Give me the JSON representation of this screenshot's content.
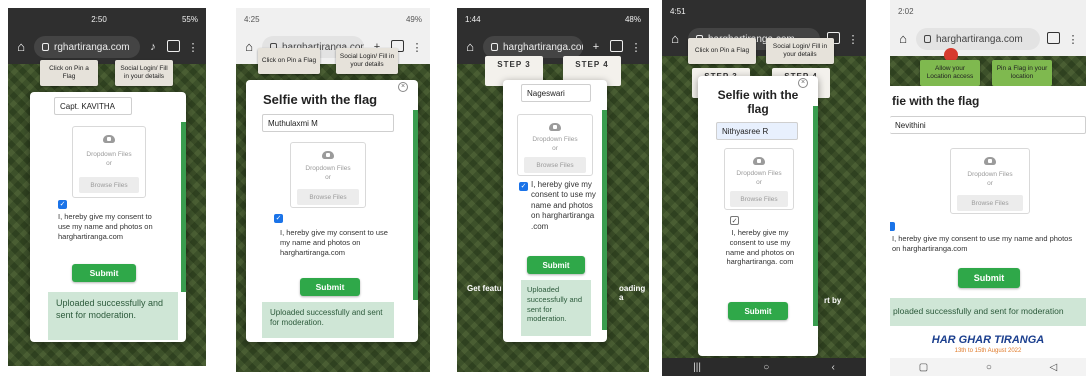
{
  "phone1": {
    "status": {
      "time": "2:50",
      "battery": "55%"
    },
    "url": "rghartiranga.com",
    "buttons": [
      "Click on Pin a Flag",
      "Social Login/ Fill in your details"
    ],
    "name_value": "Capt. KAVITHA",
    "dropzone": {
      "line1": "Dropdown Files",
      "line2": "or",
      "browse": "Browse Files"
    },
    "consent": "I, hereby give my consent to use my name and photos on harghartiranga.com",
    "submit": "Submit",
    "success": "Uploaded successfully and sent for moderation."
  },
  "phone2": {
    "status": {
      "time": "4:25",
      "battery": "49%"
    },
    "url": "harghartiranga.com",
    "buttons": [
      "Click on Pin a Flag",
      "Social Login/ Fill in your details"
    ],
    "title": "Selfie with the flag",
    "name_value": "Muthulaxmi M",
    "dropzone": {
      "line1": "Dropdown Files",
      "line2": "or",
      "browse": "Browse Files"
    },
    "consent": "I, hereby give my consent to use my name and photos on harghartiranga.com",
    "submit": "Submit",
    "success": "Uploaded successfully and sent for moderation."
  },
  "phone3": {
    "status": {
      "time": "1:44",
      "battery": "48%"
    },
    "url": "harghartiranga.com",
    "steps": [
      "STEP 3",
      "STEP 4"
    ],
    "name_value": "Nageswari",
    "dropzone": {
      "line1": "Dropdown Files",
      "line2": "or",
      "browse": "Browse Files"
    },
    "consent": "I, hereby give my consent to use my name and photos on harghartiranga .com",
    "submit": "Submit",
    "success": "Uploaded successfully and sent for moderation.",
    "bg_left": "Get featu",
    "bg_right": "oading a"
  },
  "phone4": {
    "status": {
      "time": "4:51"
    },
    "url": "harghartiranga.com",
    "buttons": [
      "Click on Pin a Flag",
      "Social Login/ Fill in your details"
    ],
    "steps": [
      "STEP 3",
      "STEP 4"
    ],
    "title": "Selfie with the flag",
    "name_value": "Nithyasree R",
    "dropzone": {
      "line1": "Dropdown Files",
      "line2": "or",
      "browse": "Browse Files"
    },
    "consent": "I, hereby give my consent to use my name and photos on harghartiranga. com",
    "submit": "Submit",
    "bg_right": "rt by"
  },
  "phone5": {
    "status": {
      "time": "2:02"
    },
    "url": "harghartiranga.com",
    "buttons": [
      "Allow your Location access",
      "Pin a Flag in your location"
    ],
    "title": "fie with the flag",
    "name_value": "Nevithini",
    "dropzone": {
      "line1": "Dropdown Files",
      "line2": "or",
      "browse": "Browse Files"
    },
    "consent": "I, hereby give my consent to use my name and photos on harghartiranga.com",
    "submit": "Submit",
    "success": "ploaded successfully and sent for moderation",
    "banner": "HAR GHAR TIRANGA",
    "banner_sub": "13th to 15th August 2022"
  },
  "nav_icons": [
    "recent-apps-icon",
    "home-circle-icon",
    "back-triangle-icon"
  ],
  "colors": {
    "submit_green": "#2fa849",
    "success_bg": "#cfe6d6",
    "checkbox_blue": "#1a73e8"
  }
}
